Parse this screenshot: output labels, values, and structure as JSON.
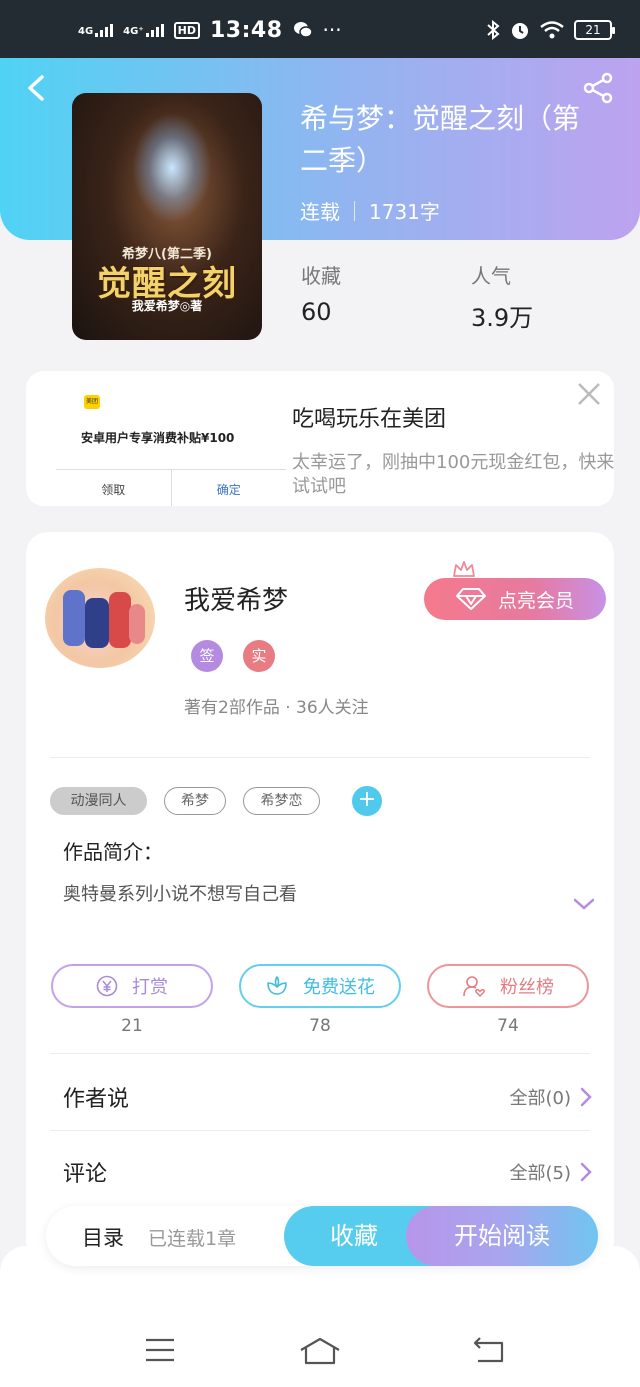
{
  "status_bar": {
    "net1": "4G",
    "net2": "4G⁺",
    "hd": "HD",
    "time": "13:48",
    "dots": "···",
    "battery": "21"
  },
  "book": {
    "title": "希与梦：觉醒之刻（第二季）",
    "status": "连载",
    "word_count": "1731字",
    "cover": {
      "series": "希梦八(第二季)",
      "title": "觉醒之刻",
      "author": "我爱希梦◎著"
    }
  },
  "stats": {
    "favorites_label": "收藏",
    "favorites_value": "60",
    "popularity_label": "人气",
    "popularity_value": "3.9万"
  },
  "ad": {
    "logo": "美团",
    "thumb_line": "安卓用户专享消费补贴¥100",
    "thumb_btn_left": "领取",
    "thumb_btn_right": "确定",
    "title": "吃喝玩乐在美团",
    "text": "太幸运了，刚抽中100元现金红包，快来试试吧"
  },
  "author": {
    "name": "我爱希梦",
    "badge_sign": "签",
    "badge_real": "实",
    "stats": "著有2部作品 · 36人关注",
    "vip_button": "点亮会员"
  },
  "tags": [
    "动漫同人",
    "希梦",
    "希梦恋"
  ],
  "add_tag": "+",
  "intro": {
    "label": "作品简介：",
    "text": "奥特曼系列小说不想写自己看"
  },
  "actions": {
    "tip_label": "打赏",
    "tip_count": "21",
    "flower_label": "免费送花",
    "flower_count": "78",
    "fans_label": "粉丝榜",
    "fans_count": "74"
  },
  "sections": {
    "author_says": "作者说",
    "author_says_link": "全部(0)",
    "comments": "评论",
    "comments_link": "全部(5)"
  },
  "bottom_bar": {
    "toc": "目录",
    "serial": "已连载1章",
    "favorite": "收藏",
    "read": "开始阅读"
  },
  "colors": {
    "accent_cyan": "#56cdee",
    "accent_purple": "#b796ea",
    "tip_color": "#b48be0",
    "flower_color": "#4fc9ec",
    "fans_color": "#e87c82"
  },
  "icons": [
    "back-icon",
    "share-icon",
    "close-icon",
    "crown-icon",
    "diamond-icon",
    "yen-icon",
    "flower-icon",
    "fans-icon",
    "chevron-right-icon",
    "chevron-down-icon",
    "menu-icon",
    "home-icon",
    "return-icon"
  ]
}
